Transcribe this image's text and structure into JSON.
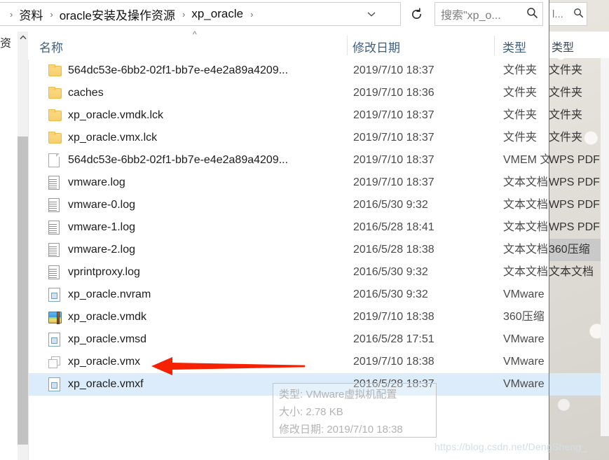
{
  "window": {
    "address_bar": {
      "breadcrumbs": [
        "资料",
        "oracle安装及操作资源",
        "xp_oracle"
      ],
      "separator": "›",
      "dropdown_icon": "chevron-down-icon",
      "refresh_icon": "refresh-icon",
      "refresh_glyph": "↻"
    },
    "search": {
      "placeholder": "搜索\"xp_o...",
      "icon": "search-icon"
    },
    "columns": [
      {
        "label": "名称"
      },
      {
        "label": "修改日期"
      },
      {
        "label": "类型"
      }
    ],
    "sort_indicator": "^",
    "left_clipped_label": "资"
  },
  "files": [
    {
      "name": "564dc53e-6bb2-02f1-bb7e-e4e2a89a4209...",
      "date": "2019/7/10 18:37",
      "type": "文件夹",
      "icon": "folder-icon",
      "kind": "folder",
      "selected": false
    },
    {
      "name": "caches",
      "date": "2019/7/10 18:36",
      "type": "文件夹",
      "icon": "folder-icon",
      "kind": "folder",
      "selected": false
    },
    {
      "name": "xp_oracle.vmdk.lck",
      "date": "2019/7/10 18:37",
      "type": "文件夹",
      "icon": "folder-icon",
      "kind": "folder",
      "selected": false
    },
    {
      "name": "xp_oracle.vmx.lck",
      "date": "2019/7/10 18:37",
      "type": "文件夹",
      "icon": "folder-icon",
      "kind": "folder",
      "selected": false
    },
    {
      "name": "564dc53e-6bb2-02f1-bb7e-e4e2a89a4209...",
      "date": "2019/7/10 18:37",
      "type": "VMEM 文",
      "icon": "blank-document-icon",
      "kind": "doc",
      "selected": false
    },
    {
      "name": "vmware.log",
      "date": "2019/7/10 18:37",
      "type": "文本文档",
      "icon": "text-document-icon",
      "kind": "txt",
      "selected": false
    },
    {
      "name": "vmware-0.log",
      "date": "2016/5/30 9:32",
      "type": "文本文档",
      "icon": "text-document-icon",
      "kind": "txt",
      "selected": false
    },
    {
      "name": "vmware-1.log",
      "date": "2016/5/28 18:41",
      "type": "文本文档",
      "icon": "text-document-icon",
      "kind": "txt",
      "selected": false
    },
    {
      "name": "vmware-2.log",
      "date": "2016/5/28 18:38",
      "type": "文本文档",
      "icon": "text-document-icon",
      "kind": "txt",
      "selected": false
    },
    {
      "name": "vprintproxy.log",
      "date": "2016/5/30 9:32",
      "type": "文本文档",
      "icon": "text-document-icon",
      "kind": "txt",
      "selected": false
    },
    {
      "name": "xp_oracle.nvram",
      "date": "2016/5/30 9:32",
      "type": "VMware",
      "icon": "vmware-file-icon",
      "kind": "vm",
      "selected": false
    },
    {
      "name": "xp_oracle.vmdk",
      "date": "2019/7/10 18:38",
      "type": "360压缩",
      "icon": "archive-icon",
      "kind": "zip",
      "selected": false
    },
    {
      "name": "xp_oracle.vmsd",
      "date": "2016/5/28 17:51",
      "type": "VMware",
      "icon": "vmware-file-icon",
      "kind": "vm",
      "selected": false
    },
    {
      "name": "xp_oracle.vmx",
      "date": "2019/7/10 18:38",
      "type": "VMware",
      "icon": "vmx-config-icon",
      "kind": "vmx",
      "selected": false
    },
    {
      "name": "xp_oracle.vmxf",
      "date": "2016/5/28 18:37",
      "type": "VMware",
      "icon": "vmware-file-icon",
      "kind": "vm",
      "selected": true
    }
  ],
  "tooltip": {
    "type_line": "类型: VMware虚拟机配置",
    "size_line": "大小: 2.78 KB",
    "date_line": "修改日期: 2019/7/10 18:38"
  },
  "annotation": {
    "arrow_color": "#f52100",
    "arrow_target": "xp_oracle.vmx"
  },
  "rear_window": {
    "search_placeholder": "l...",
    "search_icon": "search-icon",
    "column_label": "类型",
    "types": [
      {
        "value": "文件夹",
        "state": "normal"
      },
      {
        "value": "文件夹",
        "state": "normal"
      },
      {
        "value": "文件夹",
        "state": "normal"
      },
      {
        "value": "文件夹",
        "state": "normal"
      },
      {
        "value": "WPS PDF",
        "state": "normal"
      },
      {
        "value": "WPS PDF",
        "state": "normal"
      },
      {
        "value": "WPS PDF",
        "state": "normal"
      },
      {
        "value": "WPS PDF",
        "state": "normal"
      },
      {
        "value": "360压缩",
        "state": "highlight"
      },
      {
        "value": "文本文档",
        "state": "normal"
      },
      {
        "value": "",
        "state": "normal"
      },
      {
        "value": "",
        "state": "normal"
      },
      {
        "value": "",
        "state": "normal"
      },
      {
        "value": "",
        "state": "normal"
      },
      {
        "value": "",
        "state": "selected"
      }
    ]
  },
  "watermark": {
    "text": "https://blog.csdn.net/DengSheng_"
  },
  "colors": {
    "selection": "#dcecfa",
    "header_text": "#3f5e7c",
    "divider": "#2f7fd0",
    "arrow": "#f52100"
  }
}
